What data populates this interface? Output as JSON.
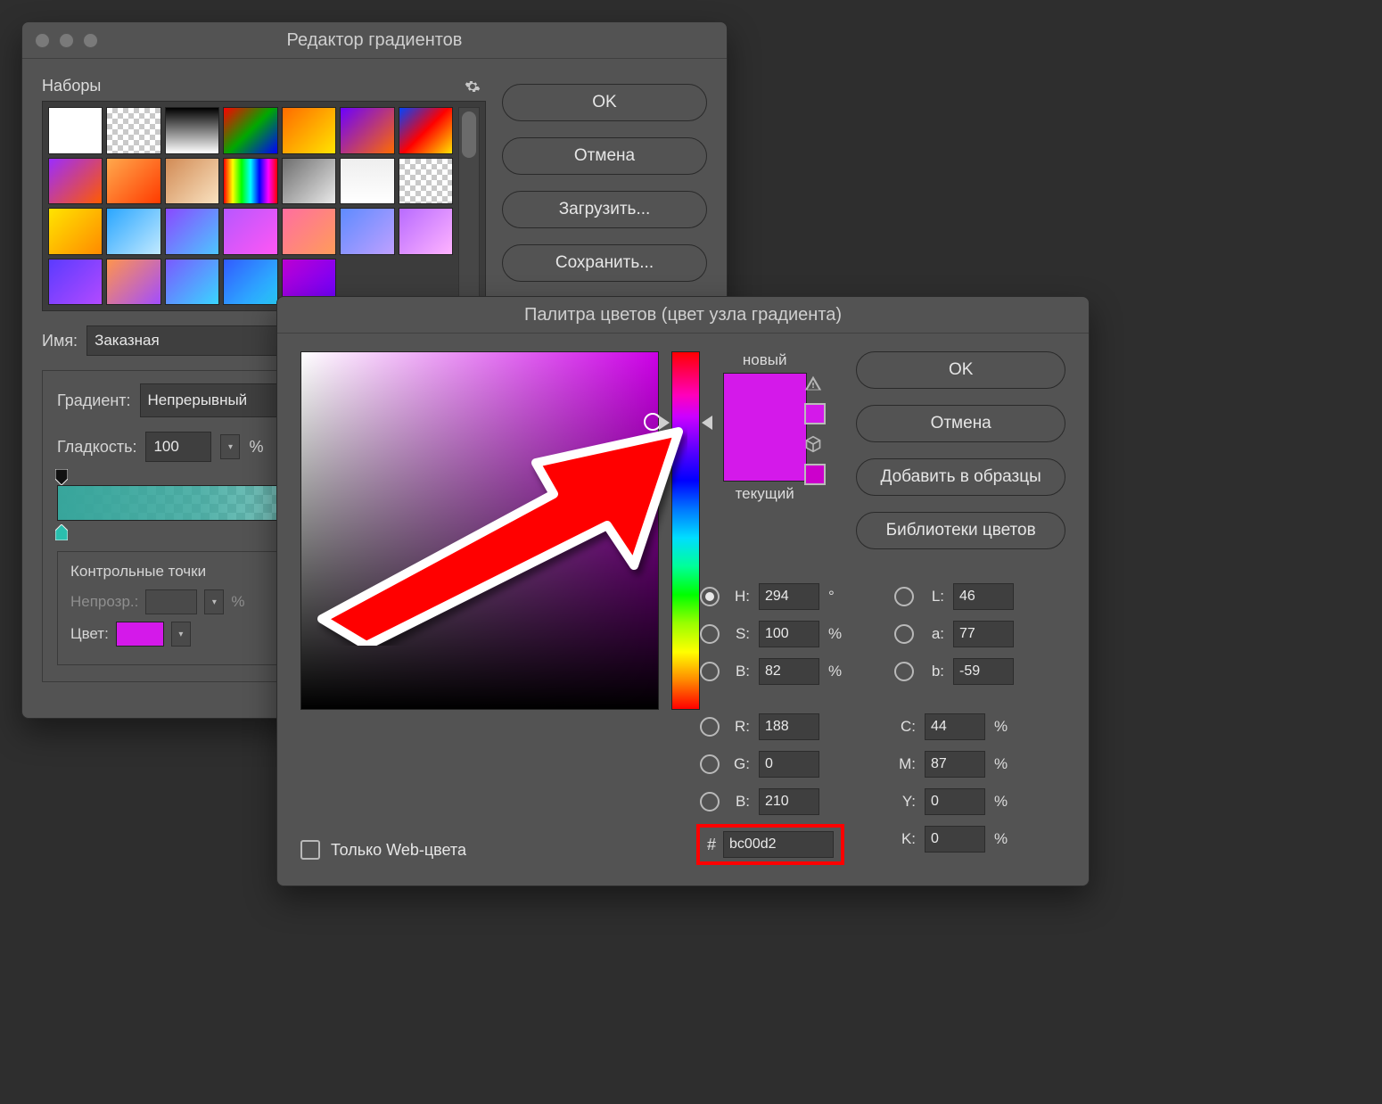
{
  "gradient_editor": {
    "title": "Редактор градиентов",
    "presets_label": "Наборы",
    "name_label": "Имя:",
    "name_value": "Заказная",
    "gradient_type_label": "Градиент:",
    "gradient_type_value": "Непрерывный",
    "smoothness_label": "Гладкость:",
    "smoothness_value": "100",
    "smoothness_unit": "%",
    "stops_label": "Контрольные точки",
    "opacity_label": "Непрозр.:",
    "opacity_unit": "%",
    "color_label": "Цвет:",
    "stop_color": "#d419ea",
    "buttons": {
      "ok": "OK",
      "cancel": "Отмена",
      "load": "Загрузить...",
      "save": "Сохранить..."
    },
    "presets": [
      "linear-gradient(180deg,#ffffff,#ffffff)",
      "repeating-conic-gradient(#c9c9c9 0 25%,#fff 0 50%) 0 0/12px 12px",
      "linear-gradient(180deg,#000,#fff)",
      "linear-gradient(135deg,#ff0000,#00a800,#0000ff)",
      "linear-gradient(135deg,#ff6b00,#ffe400)",
      "linear-gradient(135deg,#6b00ff,#ff6b00)",
      "linear-gradient(135deg,#0044ff,#ff0000,#ffe400)",
      "linear-gradient(135deg,#9b2cff,#ff5a00)",
      "linear-gradient(135deg,#ffa94d,#ff3b00)",
      "linear-gradient(135deg,#d28b55,#f9e2c0)",
      "linear-gradient(90deg,#ff0000,#ffff00,#00ff00,#00ffff,#0000ff,#ff00ff,#ff0000)",
      "linear-gradient(135deg,#6e6e6e,#e9e9e9)",
      "linear-gradient(180deg,#eeeeee,#ffffff)",
      "repeating-conic-gradient(#c9c9c9 0 25%,#fff 0 50%) 0 0/12px 12px",
      "linear-gradient(135deg,#ffe400,#ff8a00)",
      "linear-gradient(135deg,#2aa6ff,#c1e9ff)",
      "linear-gradient(135deg,#8a49ff,#4dc6ff)",
      "linear-gradient(135deg,#b757ff,#ff57f4)",
      "linear-gradient(135deg,#ff6ea0,#ff9c5a)",
      "linear-gradient(135deg,#5e8bff,#bfa0ff)",
      "linear-gradient(135deg,#b86bff,#ffb3ff)",
      "linear-gradient(135deg,#5b3bff,#b24aff)",
      "linear-gradient(135deg,#ff944d,#a24dff)",
      "linear-gradient(135deg,#7a5aff,#39d6ff)",
      "linear-gradient(135deg,#325bff,#2ad0ff)",
      "linear-gradient(135deg,#bc00d2,#6a00ff)"
    ]
  },
  "color_picker": {
    "title": "Палитра цветов (цвет узла градиента)",
    "new_label": "новый",
    "current_label": "текущий",
    "buttons": {
      "ok": "OK",
      "cancel": "Отмена",
      "add_swatch": "Добавить в образцы",
      "libraries": "Библиотеки цветов"
    },
    "web_only_label": "Только Web-цвета",
    "hsb": {
      "H": "294",
      "S": "100",
      "B": "82"
    },
    "hsb_units": {
      "H": "°",
      "S": "%",
      "B": "%"
    },
    "lab": {
      "L": "46",
      "a": "77",
      "b": "-59"
    },
    "rgb": {
      "R": "188",
      "G": "0",
      "B": "210"
    },
    "cmyk": {
      "C": "44",
      "M": "87",
      "Y": "0",
      "K": "0"
    },
    "cmyk_unit": "%",
    "hex_label": "#",
    "hex_value": "bc00d2",
    "selected_mode": "H",
    "color_new": "#d419ea",
    "color_current": "#d419ea"
  }
}
